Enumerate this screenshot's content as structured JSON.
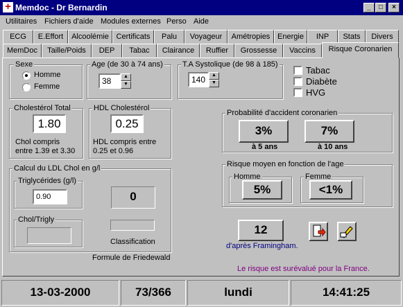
{
  "window": {
    "title": "Memdoc - Dr Bernardin"
  },
  "menu": [
    "Utilitaires",
    "Fichiers d'aide",
    "Modules externes",
    "Perso",
    "Aide"
  ],
  "tabs_row1": [
    "ECG",
    "E.Effort",
    "Alcoolémie",
    "Certificats",
    "Palu",
    "Voyageur",
    "Amétropies",
    "Energie",
    "INP",
    "Stats",
    "Divers"
  ],
  "tabs_row2": [
    "MemDoc",
    "Taille/Poids",
    "DEP",
    "Tabac",
    "Clairance",
    "Ruffier",
    "Grossesse",
    "Vaccins",
    "Risque Coronarien"
  ],
  "sexe": {
    "label": "Sexe",
    "homme": "Homme",
    "femme": "Femme",
    "selected": "Homme"
  },
  "age": {
    "label": "Age (de 30 à 74 ans)",
    "value": "38"
  },
  "ta": {
    "label": "T.A Systolique (de 98 à 185)",
    "value": "140"
  },
  "checks": {
    "tabac": "Tabac",
    "diabete": "Diabète",
    "hvg": "HVG"
  },
  "chol": {
    "label": "Cholestérol Total",
    "value": "1.80",
    "note1": "Chol compris",
    "note2": "entre 1.39 et 3.30"
  },
  "hdl": {
    "label": "HDL Cholestérol",
    "value": "0.25",
    "note1": "HDL compris entre",
    "note2": "0.25 et 0.96"
  },
  "ldl": {
    "label": "Calcul du LDL Chol en g/l",
    "trig_label": "Triglycérides (g/l)",
    "trig_value": "0.90",
    "result": "0",
    "ratio_label": "Chol/Trigly",
    "classification": "Classification",
    "formula": "Formule de Friedewald"
  },
  "proba": {
    "label": "Probabilité d'accident coronarien",
    "v5": "3%",
    "l5": "à 5 ans",
    "v10": "7%",
    "l10": "à 10 ans"
  },
  "moyen": {
    "label": "Risque moyen en fonction de l'age",
    "homme_label": "Homme",
    "homme": "5%",
    "femme_label": "Femme",
    "femme": "<1%"
  },
  "framingham": {
    "value": "12",
    "label": "d'après Framingham."
  },
  "note": "Le risque est surévalué pour la France.",
  "status": {
    "date": "13-03-2000",
    "day_count": "73/366",
    "weekday": "lundi",
    "time": "14:41:25"
  },
  "colors": {
    "titlebar": "#000080",
    "link": "#000080",
    "note": "#800080"
  }
}
